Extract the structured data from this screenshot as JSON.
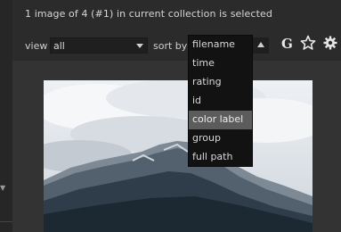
{
  "status": {
    "text": "1 image of 4 (#1) in current collection is selected"
  },
  "filter_bar": {
    "view_label": "view",
    "view_value": "all",
    "sort_label": "sort by",
    "group_icon_glyph": "G",
    "icons": [
      "sort-direction-icon",
      "grouping-icon",
      "star-icon",
      "gear-icon"
    ]
  },
  "sort_menu": {
    "items": [
      "filename",
      "time",
      "rating",
      "id",
      "color label",
      "group",
      "full path"
    ],
    "highlighted": "color label"
  },
  "colors": {
    "background": "#2b2b2b",
    "menu_background": "#121212",
    "menu_highlight": "#5c5c5c"
  }
}
